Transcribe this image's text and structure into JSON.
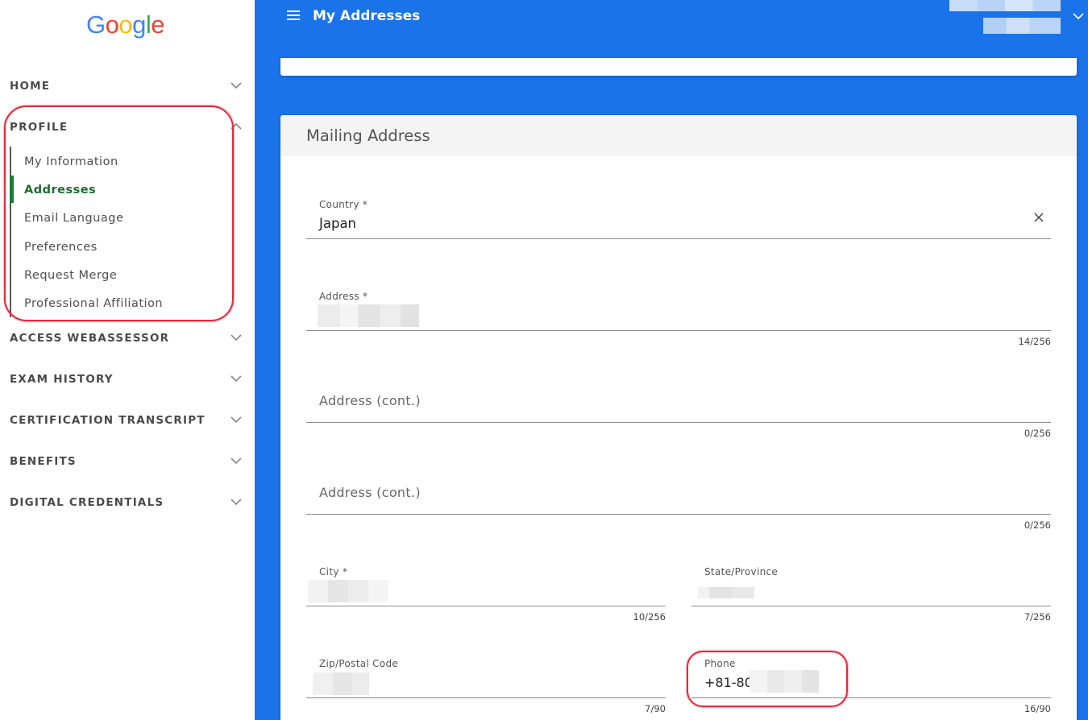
{
  "sidebar": {
    "logo": "Google",
    "logo_colors": [
      "#4285F4",
      "#EA4335",
      "#FBBC05",
      "#4285F4",
      "#34A853",
      "#EA4335"
    ],
    "nav": [
      {
        "label": "HOME",
        "expanded": false
      },
      {
        "label": "PROFILE",
        "expanded": true
      },
      {
        "label": "ACCESS WEBASSESSOR",
        "expanded": false
      },
      {
        "label": "EXAM HISTORY",
        "expanded": false
      },
      {
        "label": "CERTIFICATION TRANSCRIPT",
        "expanded": false
      },
      {
        "label": "BENEFITS",
        "expanded": false
      },
      {
        "label": "DIGITAL CREDENTIALS",
        "expanded": false
      }
    ],
    "profile_items": [
      {
        "label": "My Information",
        "active": false
      },
      {
        "label": "Addresses",
        "active": true
      },
      {
        "label": "Email Language",
        "active": false
      },
      {
        "label": "Preferences",
        "active": false
      },
      {
        "label": "Request Merge",
        "active": false
      },
      {
        "label": "Professional Affiliation",
        "active": false
      }
    ]
  },
  "header": {
    "title": "My Addresses",
    "menu_icon": "hamburger-menu-icon",
    "user_menu_icon": "chevron-down-icon"
  },
  "mailing": {
    "title": "Mailing Address",
    "country": {
      "label": "Country *",
      "value": "Japan",
      "clear_icon": "close-icon"
    },
    "address1": {
      "label": "Address *",
      "counter": "14/256"
    },
    "address2": {
      "placeholder": "Address (cont.)",
      "counter": "0/256"
    },
    "address3": {
      "placeholder": "Address (cont.)",
      "counter": "0/256"
    },
    "city": {
      "label": "City *",
      "counter": "10/256"
    },
    "state": {
      "label": "State/Province",
      "counter": "7/256"
    },
    "zip": {
      "label": "Zip/Postal Code",
      "counter": "7/90"
    },
    "phone": {
      "label": "Phone",
      "value": "+81-80-",
      "counter": "16/90"
    }
  },
  "colors": {
    "primary": "#1a73e8",
    "active_nav": "#1e6b2d",
    "annotation": "#e8283a"
  }
}
